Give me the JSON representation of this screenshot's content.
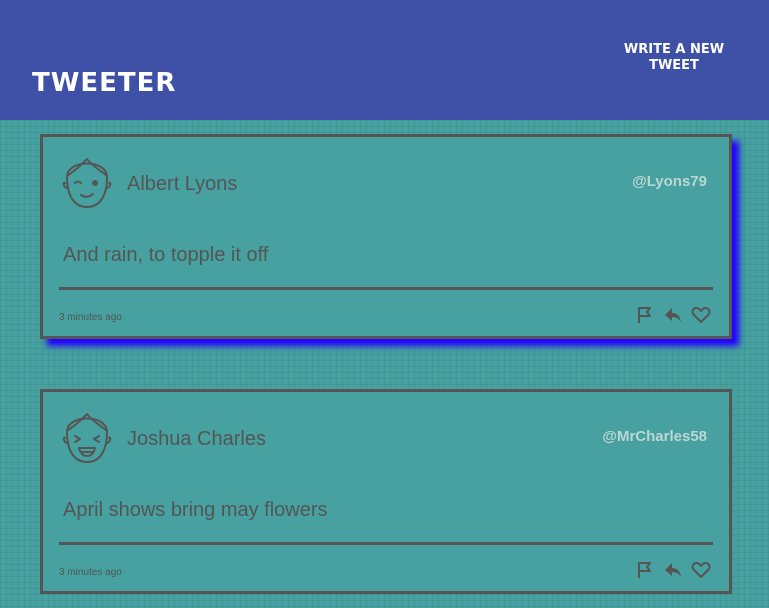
{
  "header": {
    "title": "TWEETER",
    "compose_label": "WRITE A NEW TWEET"
  },
  "tweets": [
    {
      "name": "Albert Lyons",
      "handle": "@Lyons79",
      "text": "And rain, to topple it off",
      "time": "3 minutes ago",
      "avatar_icon": "winking-face-avatar-icon"
    },
    {
      "name": "Joshua Charles",
      "handle": "@MrCharles58",
      "text": "April shows bring may flowers",
      "time": "3 minutes ago",
      "avatar_icon": "laughing-face-avatar-icon"
    }
  ],
  "icons": [
    "flag-icon",
    "reply-icon",
    "heart-icon"
  ],
  "colors": {
    "header_bg": "#3f51a6",
    "page_bg": "#46a1a0",
    "card_border": "#555555",
    "highlight_shadow": "#2200ff",
    "handle_text": "#bcd6d4"
  }
}
